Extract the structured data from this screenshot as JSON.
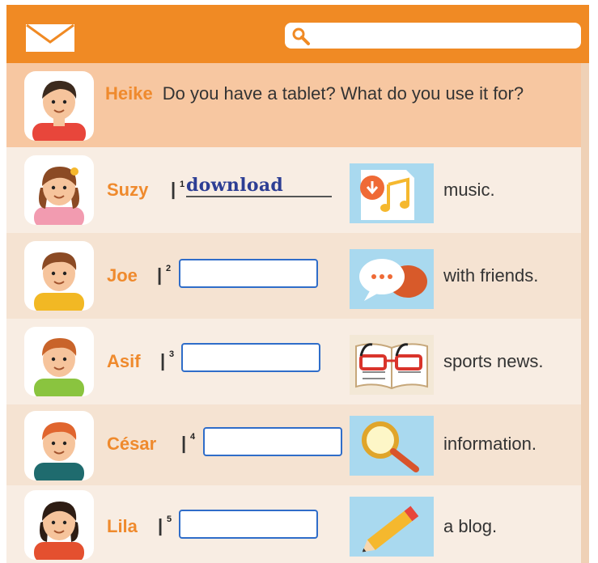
{
  "header": {
    "mail_icon": "envelope-icon",
    "search_icon": "magnifier-icon",
    "search_value": ""
  },
  "question": {
    "name": "Heike",
    "text": "Do you have a tablet? What do you use it for?"
  },
  "separator": "|",
  "rows": [
    {
      "name": "Suzy",
      "num": "1",
      "answer": "download",
      "phrase": "music.",
      "icon": "music-download-icon"
    },
    {
      "name": "Joe",
      "num": "2",
      "answer": "",
      "phrase": "with friends.",
      "icon": "chat-bubbles-icon"
    },
    {
      "name": "Asif",
      "num": "3",
      "answer": "",
      "phrase": "sports news.",
      "icon": "reading-glasses-book-icon"
    },
    {
      "name": "César",
      "num": "4",
      "answer": "",
      "phrase": "information.",
      "icon": "magnifying-glass-icon"
    },
    {
      "name": "Lila",
      "num": "5",
      "answer": "",
      "phrase": "a blog.",
      "icon": "pencil-icon"
    }
  ],
  "colors": {
    "header": "#f08a24",
    "name": "#ef8a2d",
    "blank_border": "#2f6dc9",
    "handwriting": "#2d3e94",
    "picture_bg": "#a9d9ef"
  }
}
